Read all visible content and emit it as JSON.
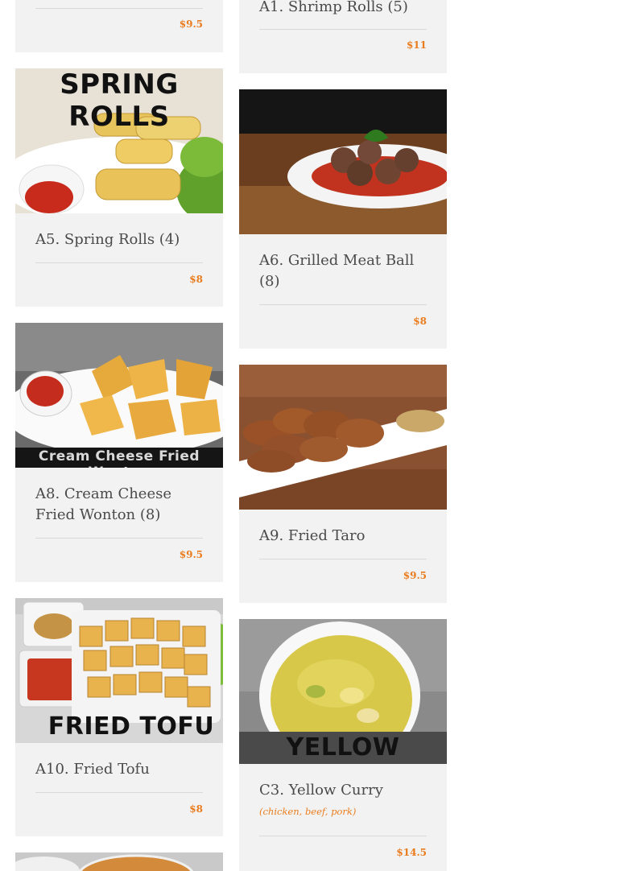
{
  "menu": {
    "items": [
      {
        "id": "top-left",
        "price": "$9.5"
      },
      {
        "id": "a1",
        "title": "A1. Shrimp Rolls (5)",
        "price": "$11"
      },
      {
        "id": "a5",
        "title": "A5. Spring Rolls (4)",
        "price": "$8",
        "image_caption": "SPRING ROLLS"
      },
      {
        "id": "a6",
        "title": "A6. Grilled Meat Ball (8)",
        "price": "$8"
      },
      {
        "id": "a8",
        "title": "A8. Cream Cheese Fried Wonton (8)",
        "price": "$9.5",
        "image_caption": "Cream Cheese Fried Wonton"
      },
      {
        "id": "a9",
        "title": "A9. Fried Taro",
        "price": "$9.5"
      },
      {
        "id": "a10",
        "title": "A10. Fried Tofu",
        "price": "$8",
        "image_caption": "FRIED TOFU"
      },
      {
        "id": "c3",
        "title": "C3. Yellow Curry",
        "subtitle": "(chicken, beef, pork)",
        "price": "$14.5",
        "image_caption": "YELLOW CURRY"
      }
    ]
  },
  "colors": {
    "card_bg": "#f2f2f2",
    "title": "#4a4a4a",
    "price_accent": "#ea7c1d",
    "divider": "#d9d9d9"
  }
}
